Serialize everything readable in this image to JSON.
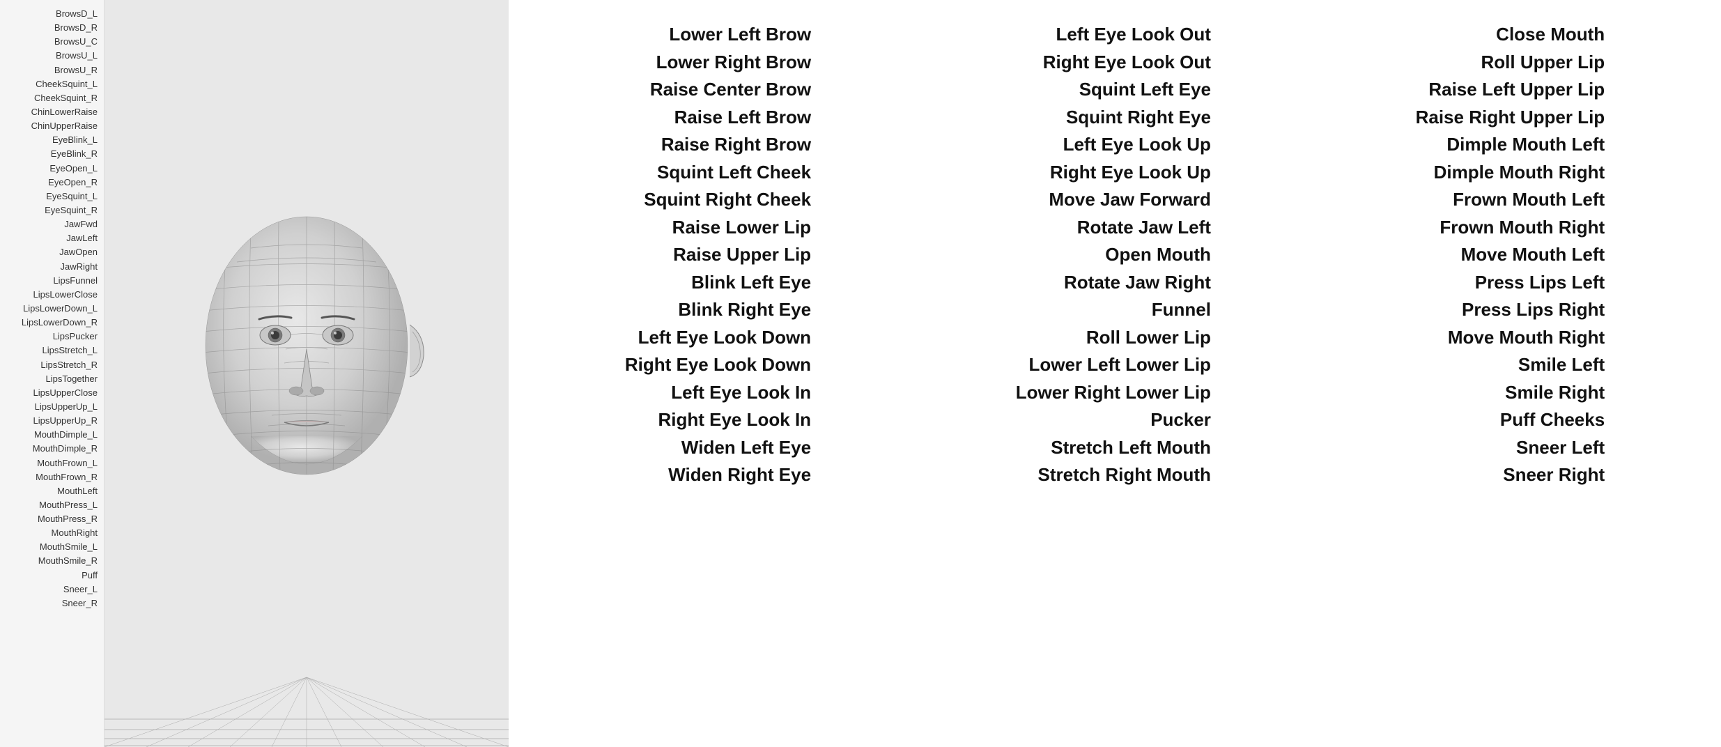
{
  "sidebar": {
    "items": [
      "BrowsD_L",
      "BrowsD_R",
      "BrowsU_C",
      "BrowsU_L",
      "BrowsU_R",
      "CheekSquint_L",
      "CheekSquint_R",
      "ChinLowerRaise",
      "ChinUpperRaise",
      "EyeBlink_L",
      "EyeBlink_R",
      "EyeOpen_L",
      "EyeOpen_R",
      "EyeSquint_L",
      "EyeSquint_R",
      "JawFwd",
      "JawLeft",
      "JawOpen",
      "JawRight",
      "LipsFunnel",
      "LipsLowerClose",
      "LipsLowerDown_L",
      "LipsLowerDown_R",
      "LipsPucker",
      "LipsStretch_L",
      "LipsStretch_R",
      "LipsTogether",
      "LipsUpperClose",
      "LipsUpperUp_L",
      "LipsUpperUp_R",
      "MouthDimple_L",
      "MouthDimple_R",
      "MouthFrown_L",
      "MouthFrown_R",
      "MouthLeft",
      "MouthPress_L",
      "MouthPress_R",
      "MouthRight",
      "MouthSmile_L",
      "MouthSmile_R",
      "Puff",
      "Sneer_L",
      "Sneer_R"
    ]
  },
  "morphColumns": {
    "col1": [
      "Lower Left Brow",
      "Lower Right Brow",
      "Raise Center Brow",
      "Raise Left Brow",
      "Raise Right Brow",
      "Squint Left Cheek",
      "Squint Right Cheek",
      "Raise Lower Lip",
      "Raise Upper Lip",
      "Blink Left Eye",
      "Blink Right Eye",
      "Left Eye Look Down",
      "Right Eye Look Down",
      "Left Eye Look In",
      "Right Eye Look In",
      "Widen Left Eye",
      "Widen Right Eye"
    ],
    "col2": [
      "Left Eye Look Out",
      "Right Eye Look Out",
      "Squint Left Eye",
      "Squint Right Eye",
      "Left Eye Look Up",
      "Right Eye Look Up",
      "Move Jaw Forward",
      "Rotate Jaw Left",
      "Open Mouth",
      "Rotate Jaw Right",
      "Funnel",
      "Roll Lower Lip",
      "Lower Left Lower Lip",
      "Lower Right Lower Lip",
      "Pucker",
      "Stretch Left Mouth",
      "Stretch Right Mouth"
    ],
    "col3": [
      "Close Mouth",
      "Roll Upper Lip",
      "Raise Left Upper Lip",
      "Raise Right Upper Lip",
      "Dimple Mouth Left",
      "Dimple Mouth Right",
      "Frown Mouth Left",
      "Frown Mouth Right",
      "Move Mouth Left",
      "Press Lips Left",
      "Press Lips Right",
      "Move Mouth Right",
      "Smile Left",
      "Smile Right",
      "Puff Cheeks",
      "Sneer Left",
      "Sneer Right"
    ]
  }
}
